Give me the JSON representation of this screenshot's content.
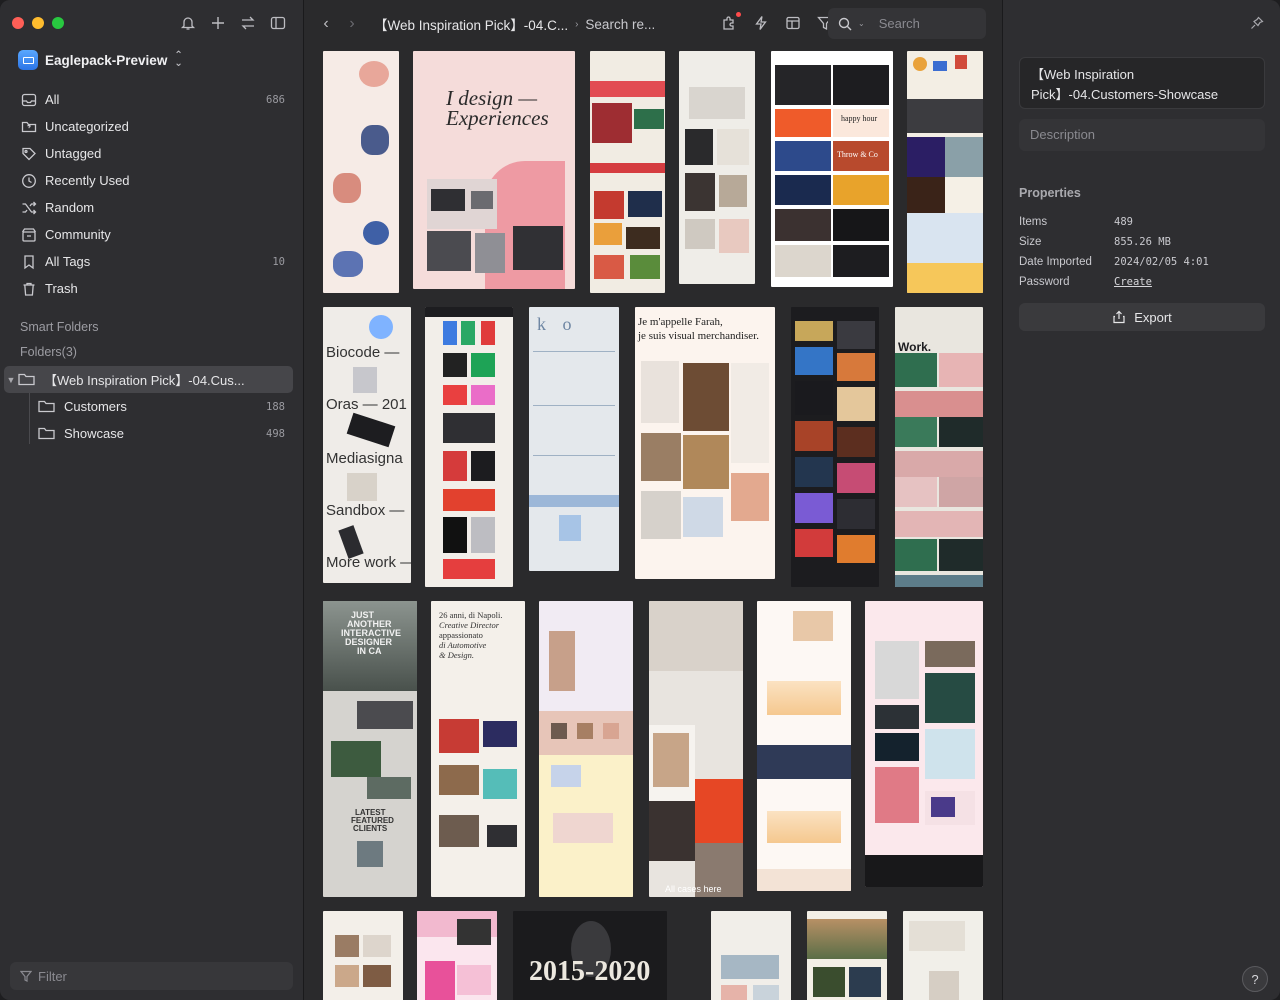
{
  "window": {
    "sidebar": {
      "library_name": "Eaglepack-Preview",
      "nav": [
        {
          "label": "All",
          "count": "686",
          "icon": "inbox-icon"
        },
        {
          "label": "Uncategorized",
          "count": "",
          "icon": "folder-question-icon"
        },
        {
          "label": "Untagged",
          "count": "",
          "icon": "tag-off-icon"
        },
        {
          "label": "Recently Used",
          "count": "",
          "icon": "clock-icon"
        },
        {
          "label": "Random",
          "count": "",
          "icon": "shuffle-icon"
        },
        {
          "label": "Community",
          "count": "",
          "icon": "community-icon"
        },
        {
          "label": "All Tags",
          "count": "10",
          "icon": "bookmark-icon"
        },
        {
          "label": "Trash",
          "count": "",
          "icon": "trash-icon"
        }
      ],
      "smart_folders_label": "Smart Folders",
      "folders_label": "Folders(3)",
      "folders": [
        {
          "label": "【Web Inspiration Pick】-04.Cus...",
          "count": ""
        },
        {
          "label": "Customers",
          "count": "188"
        },
        {
          "label": "Showcase",
          "count": "498"
        }
      ],
      "filter_placeholder": "Filter"
    },
    "toolbar": {
      "breadcrumb_1": "【Web Inspiration Pick】-04.C...",
      "breadcrumb_2": "Search re...",
      "filter_badge": "1",
      "search_placeholder": "Search"
    },
    "grid": {
      "thumb_texts": {
        "design_1": "I design —",
        "design_2": "Experiences",
        "biocode": "Biocode —",
        "oras": "Oras — 201",
        "mediasigna": "Mediasigna",
        "sandbox": "Sandbox —",
        "morework": "More work —",
        "farah_1": "Je m'appelle Farah,",
        "farah_2": "je suis visual merchandiser.",
        "work": "Work.",
        "napoli_1": "26 anni, di Napoli.",
        "napoli_2": "Creative Director",
        "napoli_3": "appassionato",
        "napoli_4": "di Automotive",
        "napoli_5": "& Design.",
        "another_1": "JUST",
        "another_2": "ANOTHER",
        "another_3": "INTERACTIVE",
        "another_4": "DESIGNER",
        "another_5": "IN CA",
        "latest_1": "LATEST",
        "latest_2": "FEATURED",
        "latest_3": "CLIENTS",
        "allcases": "All cases here",
        "year": "2015-2020",
        "happy": "happy hour",
        "throw": "Throw & Co"
      }
    },
    "inspector": {
      "name": "【Web Inspiration Pick】-04.Customers-Showcase",
      "description_placeholder": "Description",
      "properties_title": "Properties",
      "properties": [
        {
          "key": "Items",
          "value": "489"
        },
        {
          "key": "Size",
          "value": "855.26 MB"
        },
        {
          "key": "Date Imported",
          "value": "2024/02/05 4:01"
        },
        {
          "key": "Password",
          "value": "Create"
        }
      ],
      "export_label": "Export",
      "help_label": "?"
    }
  }
}
